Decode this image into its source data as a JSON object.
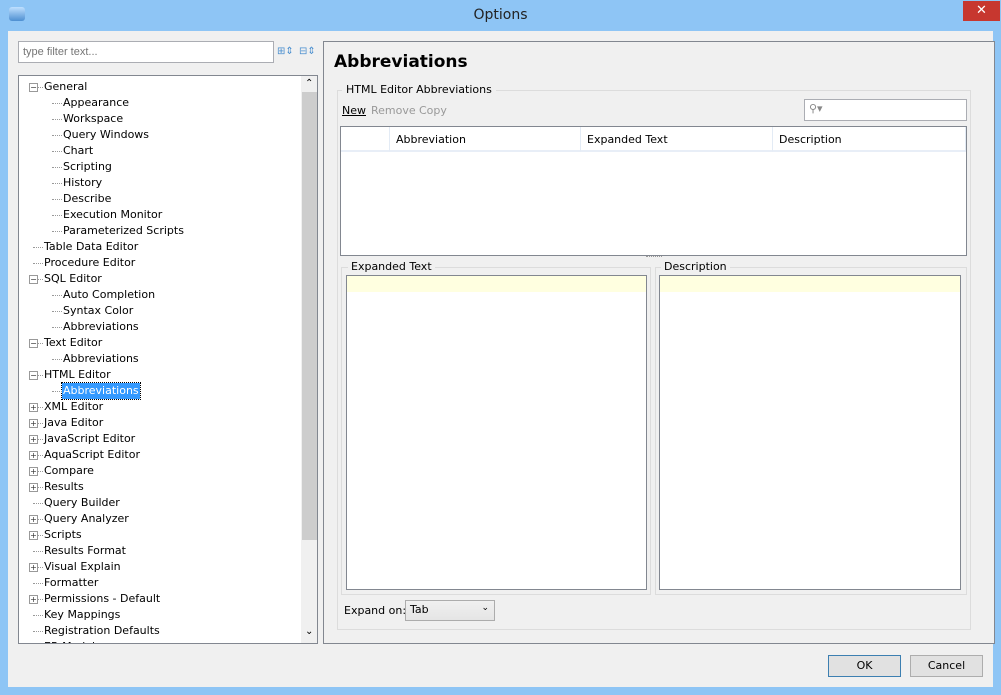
{
  "window": {
    "title": "Options",
    "close": "✕"
  },
  "filter": {
    "placeholder": "type filter text..."
  },
  "toolbar": {
    "expand_all": "expand-all-icon",
    "collapse_all": "collapse-all-icon"
  },
  "tree": [
    {
      "label": "General",
      "level": 0,
      "expander": "−"
    },
    {
      "label": "Appearance",
      "level": 1
    },
    {
      "label": "Workspace",
      "level": 1
    },
    {
      "label": "Query Windows",
      "level": 1
    },
    {
      "label": "Chart",
      "level": 1
    },
    {
      "label": "Scripting",
      "level": 1
    },
    {
      "label": "History",
      "level": 1
    },
    {
      "label": "Describe",
      "level": 1
    },
    {
      "label": "Execution Monitor",
      "level": 1
    },
    {
      "label": "Parameterized Scripts",
      "level": 1
    },
    {
      "label": "Table Data Editor",
      "level": 0
    },
    {
      "label": "Procedure Editor",
      "level": 0
    },
    {
      "label": "SQL Editor",
      "level": 0,
      "expander": "−"
    },
    {
      "label": "Auto Completion",
      "level": 1
    },
    {
      "label": "Syntax Color",
      "level": 1
    },
    {
      "label": "Abbreviations",
      "level": 1
    },
    {
      "label": "Text Editor",
      "level": 0,
      "expander": "−"
    },
    {
      "label": "Abbreviations",
      "level": 1
    },
    {
      "label": "HTML Editor",
      "level": 0,
      "expander": "−"
    },
    {
      "label": "Abbreviations",
      "level": 1,
      "selected": true
    },
    {
      "label": "XML Editor",
      "level": 0,
      "expander": "+"
    },
    {
      "label": "Java Editor",
      "level": 0,
      "expander": "+"
    },
    {
      "label": "JavaScript Editor",
      "level": 0,
      "expander": "+"
    },
    {
      "label": "AquaScript Editor",
      "level": 0,
      "expander": "+"
    },
    {
      "label": "Compare",
      "level": 0,
      "expander": "+"
    },
    {
      "label": "Results",
      "level": 0,
      "expander": "+"
    },
    {
      "label": "Query Builder",
      "level": 0
    },
    {
      "label": "Query Analyzer",
      "level": 0,
      "expander": "+"
    },
    {
      "label": "Scripts",
      "level": 0,
      "expander": "+"
    },
    {
      "label": "Results Format",
      "level": 0
    },
    {
      "label": "Visual Explain",
      "level": 0,
      "expander": "+"
    },
    {
      "label": "Formatter",
      "level": 0
    },
    {
      "label": "Permissions - Default",
      "level": 0,
      "expander": "+"
    },
    {
      "label": "Key Mappings",
      "level": 0
    },
    {
      "label": "Registration Defaults",
      "level": 0
    },
    {
      "label": "ER Modeler",
      "level": 0
    }
  ],
  "panel": {
    "title": "Abbreviations",
    "group_label": "HTML Editor Abbreviations",
    "actions": {
      "new": "New",
      "remove": "Remove",
      "copy": "Copy"
    },
    "search_icon": "search-icon",
    "columns": [
      "Abbreviation",
      "Expanded Text",
      "Description"
    ],
    "expanded_text_label": "Expanded Text",
    "description_label": "Description",
    "expand_on_label": "Expand on:",
    "expand_on_value": "Tab"
  },
  "buttons": {
    "ok": "OK",
    "cancel": "Cancel"
  }
}
